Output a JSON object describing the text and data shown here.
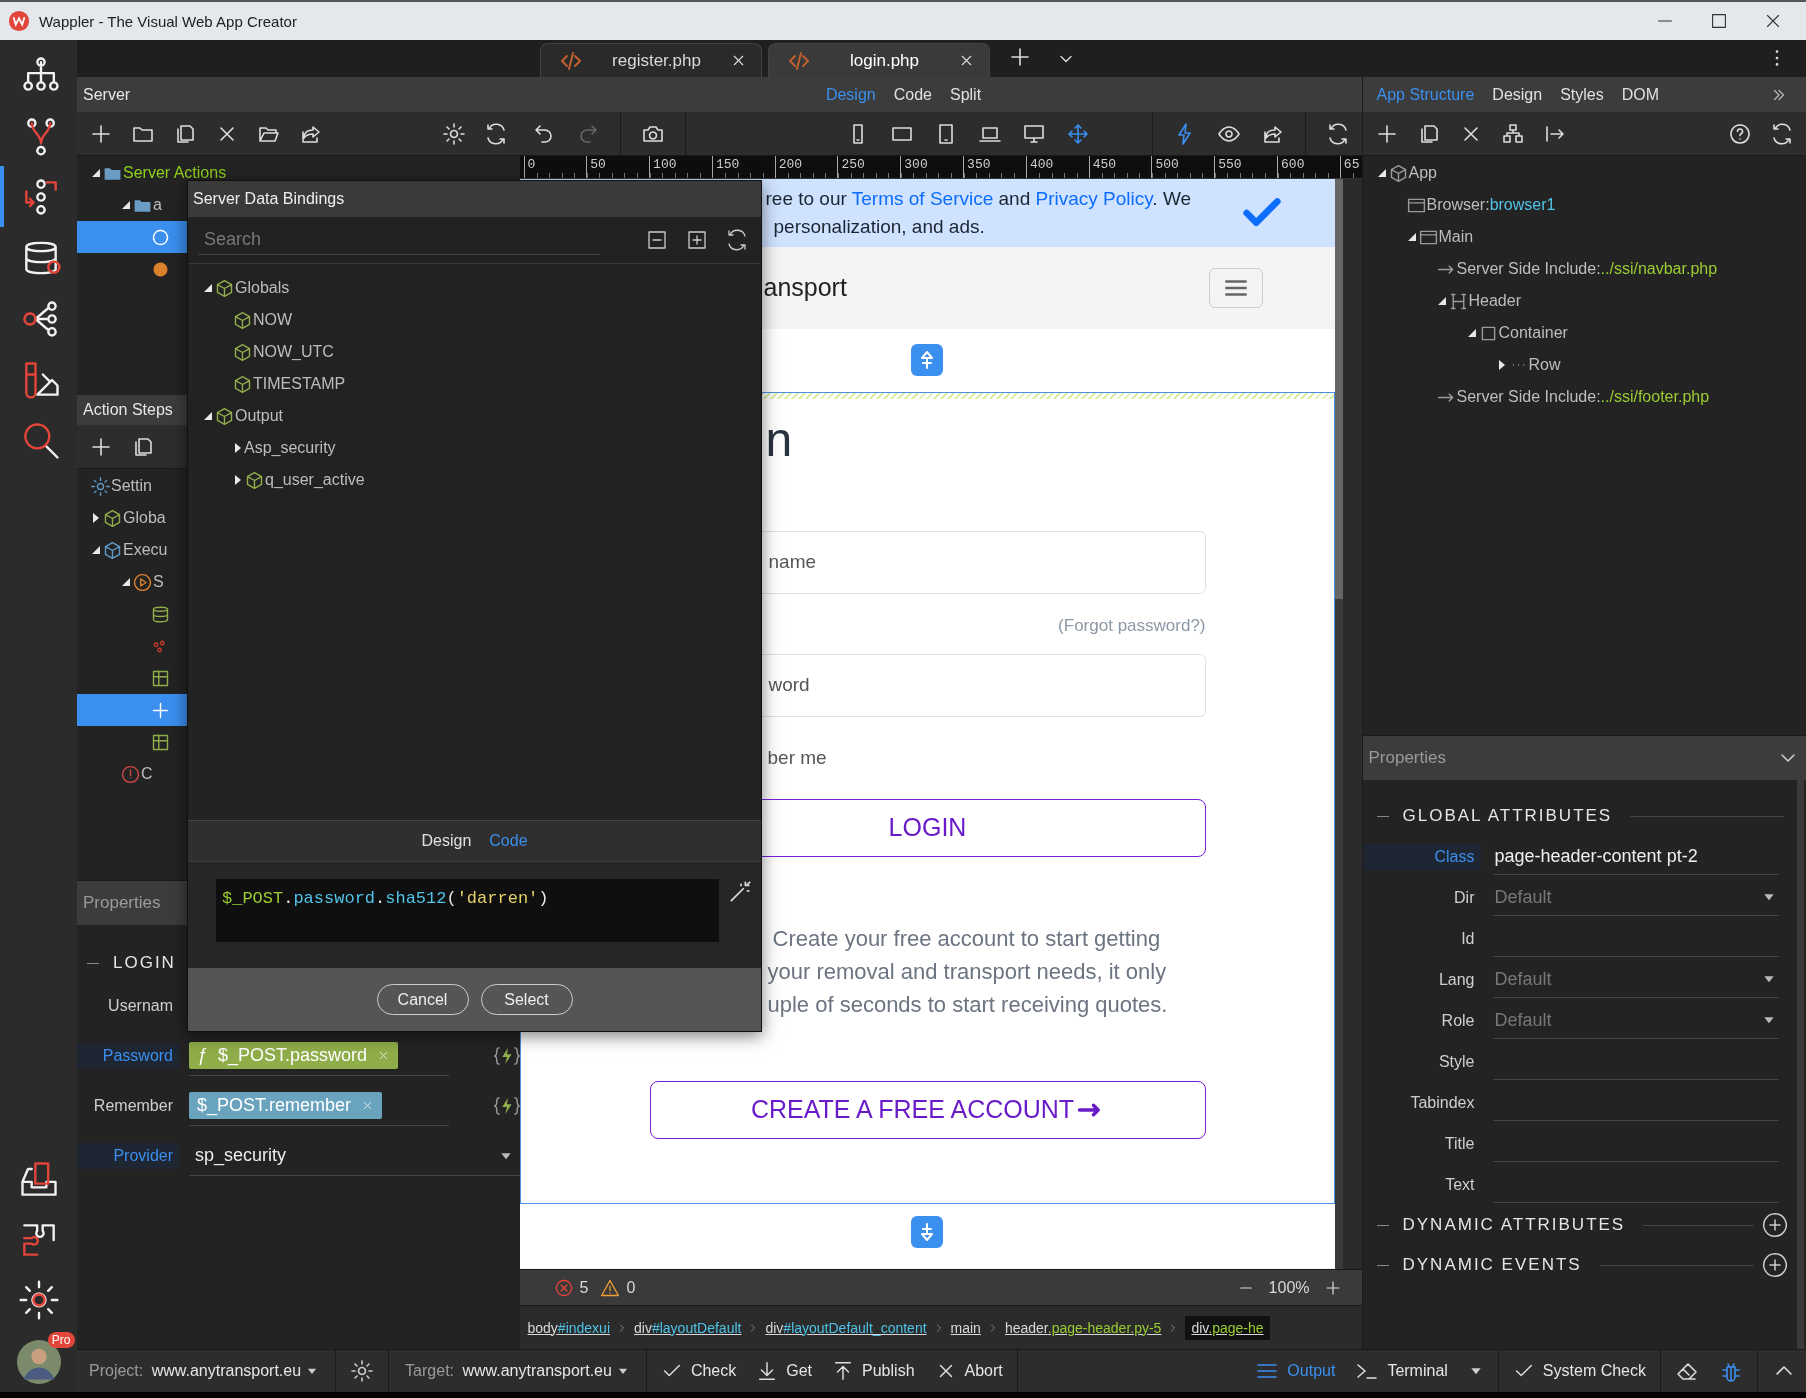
{
  "window": {
    "title": "Wappler - The Visual Web App Creator"
  },
  "rail": [
    {
      "selected": false
    },
    {
      "selected": false
    },
    {
      "selected": true
    },
    {
      "selected": false
    },
    {
      "selected": false
    },
    {
      "selected": false
    },
    {
      "selected": false
    }
  ],
  "account": {
    "badge": "Pro"
  },
  "file_tabs": [
    {
      "label": "register.php",
      "selected": false
    },
    {
      "label": "login.php",
      "selected": true
    }
  ],
  "server_panel": {
    "title": "Server",
    "tree": [
      {
        "label": "Server Actions",
        "kind": "folder",
        "expanded": true,
        "color": "#8fd01a",
        "children": [
          {
            "label": "a",
            "kind": "folder",
            "expanded": true,
            "children": [
              {
                "kind": "action",
                "selected": true
              },
              {
                "kind": "library",
                "selected": false
              }
            ]
          }
        ]
      }
    ]
  },
  "action_steps": {
    "title": "Action Steps",
    "tree": [
      {
        "label": "Settin",
        "kind": "settings"
      },
      {
        "label": "Globa",
        "kind": "globals",
        "expanded": false
      },
      {
        "label": "Execu",
        "kind": "exec",
        "expanded": true,
        "children": [
          {
            "label": "S",
            "kind": "step",
            "expanded": true,
            "children": [
              {
                "kind": "database",
                "selected": false
              },
              {
                "kind": "security",
                "selected": false
              },
              {
                "kind": "table",
                "selected": false
              },
              {
                "kind": "set",
                "selected": true
              },
              {
                "kind": "table",
                "selected": false
              }
            ]
          },
          {
            "label": "C",
            "kind": "error"
          }
        ]
      }
    ]
  },
  "properties_left": {
    "title": "Properties",
    "section": "LOGIN",
    "fields": [
      {
        "label": "Usernam",
        "kind": "hidden",
        "bound": false
      },
      {
        "label": "Password",
        "kind": "tag",
        "bound": true,
        "prefix": "ƒ",
        "value": "$_POST.password",
        "color": "#8fae4a"
      },
      {
        "label": "Remember",
        "kind": "tag",
        "bound": false,
        "value": "$_POST.remember",
        "color": "#6aa3bd"
      },
      {
        "label": "Provider",
        "kind": "select",
        "bound": true,
        "value": "sp_security"
      }
    ]
  },
  "canvas": {
    "view_modes": [
      {
        "label": "Design",
        "selected": true
      },
      {
        "label": "Code",
        "selected": false
      },
      {
        "label": "Split",
        "selected": false
      }
    ],
    "ruler": [
      "0",
      "50",
      "100",
      "150",
      "200",
      "250",
      "300",
      "350",
      "400",
      "450",
      "500",
      "550",
      "600",
      "65"
    ],
    "preview": {
      "cookie": [
        {
          "text": "ree to our ",
          "link": false
        },
        {
          "text": "Terms of Service",
          "link": true
        },
        {
          "text": " and ",
          "link": false
        },
        {
          "text": "Privacy Policy",
          "link": true
        },
        {
          "text": ". We",
          "link": false
        }
      ],
      "cookie_line2": "personalization, and ads.",
      "brand": "ansport",
      "heading": "n",
      "username_placeholder": "name",
      "forgot": "(Forgot password?)",
      "password_placeholder": "word",
      "remember": "ber me",
      "login": "LOGIN",
      "paragraph": [
        "Create your free account to start getting",
        "your removal and transport needs, it only",
        "uple of seconds to start receiving quotes."
      ],
      "create": "CREATE A FREE ACCOUNT"
    },
    "errors": "5",
    "warnings": "0",
    "zoom": "100%",
    "breadcrumb": [
      {
        "tag": "body",
        "id": "#indexui",
        "selected": false
      },
      {
        "tag": "div",
        "id": "#layoutDefault",
        "selected": false
      },
      {
        "tag": "div",
        "id": "#layoutDefault_content",
        "selected": false
      },
      {
        "tag": "main",
        "selected": false
      },
      {
        "tag": "header",
        "cls": ".page-header.py-5",
        "selected": false
      },
      {
        "tag": "div",
        "cls": ".page-he",
        "selected": true
      }
    ]
  },
  "dialog": {
    "title": "Server Data Bindings",
    "search_placeholder": "Search",
    "tree": [
      {
        "label": "Globals",
        "kind": "object",
        "expanded": true,
        "children": [
          {
            "label": "NOW",
            "kind": "object"
          },
          {
            "label": "NOW_UTC",
            "kind": "object"
          },
          {
            "label": "TIMESTAMP",
            "kind": "object"
          }
        ]
      },
      {
        "label": "Output",
        "kind": "object",
        "expanded": true,
        "children": [
          {
            "label": "sp_security",
            "glyph": "A",
            "expanded": false
          },
          {
            "label": "q_user_active",
            "kind": "object",
            "expanded": false
          }
        ]
      }
    ],
    "tabs": [
      {
        "label": "Design",
        "selected": false
      },
      {
        "label": "Code",
        "selected": true
      }
    ],
    "code": [
      {
        "text": "$_POST",
        "kind": "var"
      },
      {
        "text": ".",
        "kind": "punct"
      },
      {
        "text": "password",
        "kind": "prop"
      },
      {
        "text": ".",
        "kind": "punct"
      },
      {
        "text": "sha512",
        "kind": "prop"
      },
      {
        "text": "(",
        "kind": "punct"
      },
      {
        "text": "'darren'",
        "kind": "string"
      },
      {
        "text": ")",
        "kind": "punct"
      }
    ],
    "buttons": [
      "Cancel",
      "Select"
    ]
  },
  "structure_panel": {
    "tabs": [
      {
        "label": "App Structure",
        "selected": true
      },
      {
        "label": "Design",
        "selected": false
      },
      {
        "label": "Styles",
        "selected": false
      },
      {
        "label": "DOM",
        "selected": false
      }
    ],
    "tree": [
      {
        "label": "App",
        "kind": "app",
        "expanded": true,
        "children": [
          {
            "label": "Browser: ",
            "value": "browser1",
            "color": "#4fc3e8",
            "kind": "window"
          },
          {
            "label": "Main",
            "kind": "window",
            "expanded": true,
            "children": [
              {
                "label": "Server Side Include: ",
                "value": "../ssi/navbar.php",
                "color": "#9acd32",
                "kind": "include"
              },
              {
                "label": "Header",
                "kind": "heading",
                "expanded": true,
                "children": [
                  {
                    "label": "Container",
                    "kind": "container",
                    "expanded": true,
                    "children": [
                      {
                        "label": "Row",
                        "kind": "row",
                        "expanded": false
                      }
                    ]
                  }
                ]
              },
              {
                "label": "Server Side Include: ",
                "value": "../ssi/footer.php",
                "color": "#9acd32",
                "kind": "include"
              }
            ]
          }
        ]
      }
    ]
  },
  "properties_right": {
    "title": "Properties",
    "sections": [
      {
        "title": "GLOBAL ATTRIBUTES",
        "kind": "static",
        "fields": [
          {
            "label": "Class",
            "kind": "text",
            "bound": true,
            "value": "page-header-content pt-2"
          },
          {
            "label": "Dir",
            "kind": "select",
            "bound": false,
            "placeholder": "Default"
          },
          {
            "label": "Id",
            "kind": "text",
            "bound": false
          },
          {
            "label": "Lang",
            "kind": "select",
            "bound": false,
            "placeholder": "Default"
          },
          {
            "label": "Role",
            "kind": "select",
            "bound": false,
            "placeholder": "Default"
          },
          {
            "label": "Style",
            "kind": "text",
            "bound": false
          },
          {
            "label": "Tabindex",
            "kind": "text",
            "bound": false
          },
          {
            "label": "Title",
            "kind": "text",
            "bound": false
          },
          {
            "label": "Text",
            "kind": "text",
            "bound": false
          }
        ]
      },
      {
        "title": "DYNAMIC ATTRIBUTES",
        "kind": "dynamic"
      },
      {
        "title": "DYNAMIC EVENTS",
        "kind": "dynamic"
      }
    ]
  },
  "status_bar": {
    "project_label": "Project:",
    "project": "www.anytransport.eu",
    "target_label": "Target:",
    "target": "www.anytransport.eu",
    "actions": [
      {
        "label": "Check",
        "kind": "check"
      },
      {
        "label": "Get",
        "kind": "get"
      },
      {
        "label": "Publish",
        "kind": "publish"
      },
      {
        "label": "Abort",
        "kind": "abort"
      }
    ],
    "panels": [
      {
        "label": "Output",
        "kind": "output",
        "selected": true
      },
      {
        "label": "Terminal",
        "kind": "terminal",
        "selected": false
      }
    ],
    "system_check": "System Check"
  }
}
